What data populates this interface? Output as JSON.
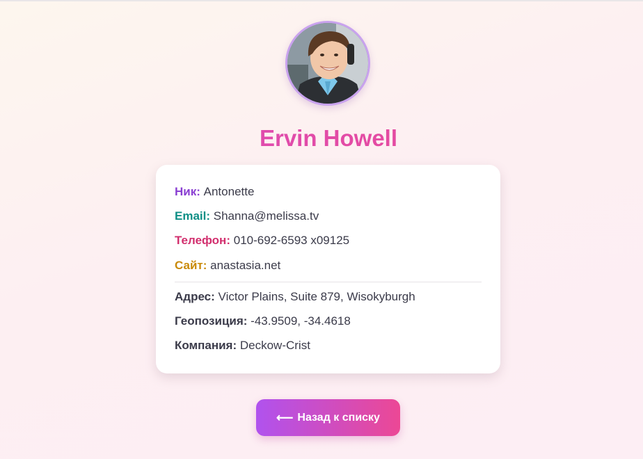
{
  "profile": {
    "name": "Ervin Howell",
    "avatar_alt": "avatar"
  },
  "details": {
    "nick": {
      "label": "Ник:",
      "value": "Antonette"
    },
    "email": {
      "label": "Email:",
      "value": "Shanna@melissa.tv"
    },
    "phone": {
      "label": "Телефон:",
      "value": "010-692-6593 x09125"
    },
    "site": {
      "label": "Сайт:",
      "value": "anastasia.net"
    },
    "address": {
      "label": "Адрес:",
      "value": "Victor Plains, Suite 879, Wisokyburgh"
    },
    "geo": {
      "label": "Геопозиция:",
      "value": "-43.9509, -34.4618"
    },
    "company": {
      "label": "Компания:",
      "value": "Deckow-Crist"
    }
  },
  "actions": {
    "back_label": "Назад к списку",
    "back_icon": "arrow-left-icon"
  },
  "colors": {
    "accent_purple": "#b052ee",
    "accent_pink": "#ec4895",
    "nick": "#8a3fd2",
    "email": "#0f8f86",
    "phone": "#d22f6e",
    "site": "#c98a0a"
  }
}
